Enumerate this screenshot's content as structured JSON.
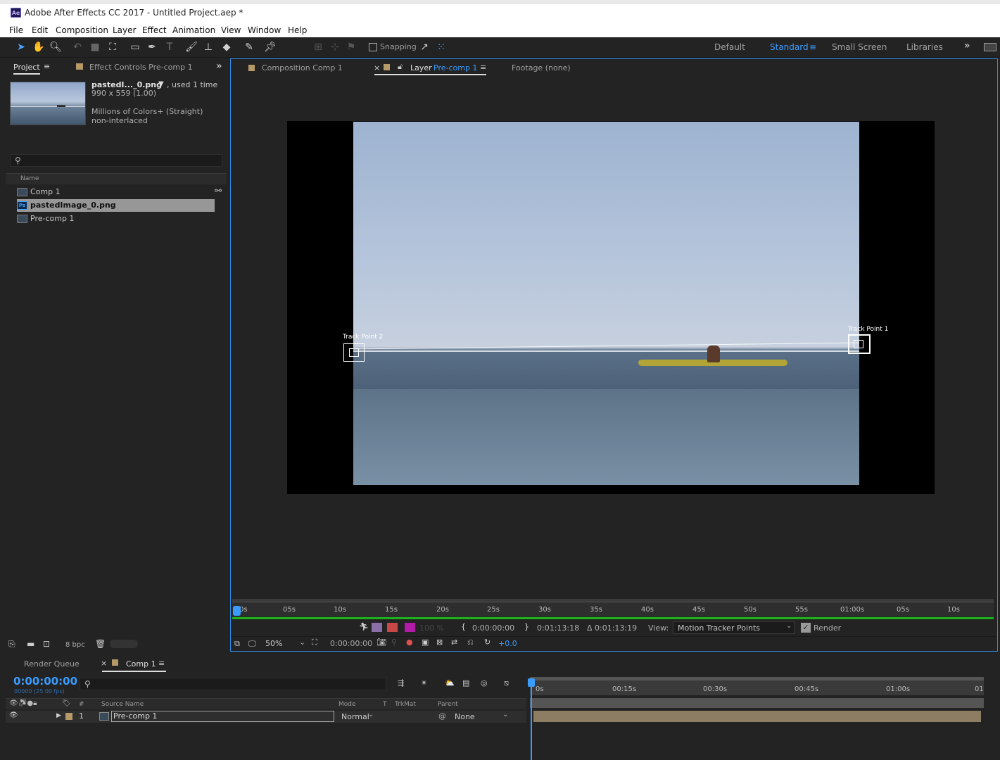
{
  "window": {
    "title": "Adobe After Effects CC 2017 - Untitled Project.aep *",
    "app_icon": "Ae"
  },
  "menu": [
    "File",
    "Edit",
    "Composition",
    "Layer",
    "Effect",
    "Animation",
    "View",
    "Window",
    "Help"
  ],
  "toolbar": {
    "snapping_label": "Snapping",
    "workspaces": [
      "Default",
      "Standard",
      "Small Screen",
      "Libraries"
    ],
    "active_workspace": "Standard",
    "overflow": "»"
  },
  "project_panel": {
    "tabs": [
      "Project",
      "Effect Controls Pre-comp 1"
    ],
    "tab_overflow": "»",
    "selected_item": {
      "name": "pastedI..._0.png",
      "usage": ", used 1 time",
      "dims": "990 x 559 (1.00)",
      "colors": "Millions of Colors+ (Straight)",
      "interlace": "non-interlaced"
    },
    "search_placeholder": "",
    "column_name": "Name",
    "items": [
      {
        "label": "Comp 1",
        "type": "comp"
      },
      {
        "label": "pastedImage_0.png",
        "type": "ps"
      },
      {
        "label": "Pre-comp 1",
        "type": "comp"
      }
    ],
    "bpc": "8 bpc"
  },
  "viewer": {
    "tabs": [
      {
        "label": "Composition Comp 1"
      },
      {
        "label": "Layer",
        "link": "Pre-comp 1"
      },
      {
        "label": "Footage (none)"
      }
    ],
    "track_points": [
      "Track Point 2",
      "Track Point 1"
    ],
    "ruler_ticks": [
      "0s",
      "05s",
      "10s",
      "15s",
      "20s",
      "25s",
      "30s",
      "35s",
      "40s",
      "45s",
      "50s",
      "55s",
      "01:00s",
      "05s",
      "10s"
    ],
    "opacity_value": "100 %",
    "in_time": "0:00:00:00",
    "out_time": "0:01:13:18",
    "duration": "Δ 0:01:13:19",
    "view_label": "View:",
    "view_value": "Motion Tracker Points",
    "render_label": "Render",
    "zoom": "50%",
    "current_time": "0:00:00:00",
    "exposure": "+0.0"
  },
  "timeline": {
    "tabs": [
      "Render Queue",
      "Comp 1"
    ],
    "timecode": "0:00:00:00",
    "fps": "00000 (25.00 fps)",
    "ruler_ticks": [
      "0s",
      "00:15s",
      "00:30s",
      "00:45s",
      "01:00s",
      "01"
    ],
    "columns": {
      "num": "#",
      "source": "Source Name",
      "mode": "Mode",
      "t": "T",
      "trkmat": "TrkMat",
      "parent": "Parent"
    },
    "layers": [
      {
        "num": "1",
        "name": "Pre-comp 1",
        "mode": "Normal",
        "parent": "None"
      }
    ]
  },
  "colors": {
    "accent": "#2d8ceb",
    "timecode": "#3b9cff",
    "track_bar": "#8c7d63"
  }
}
